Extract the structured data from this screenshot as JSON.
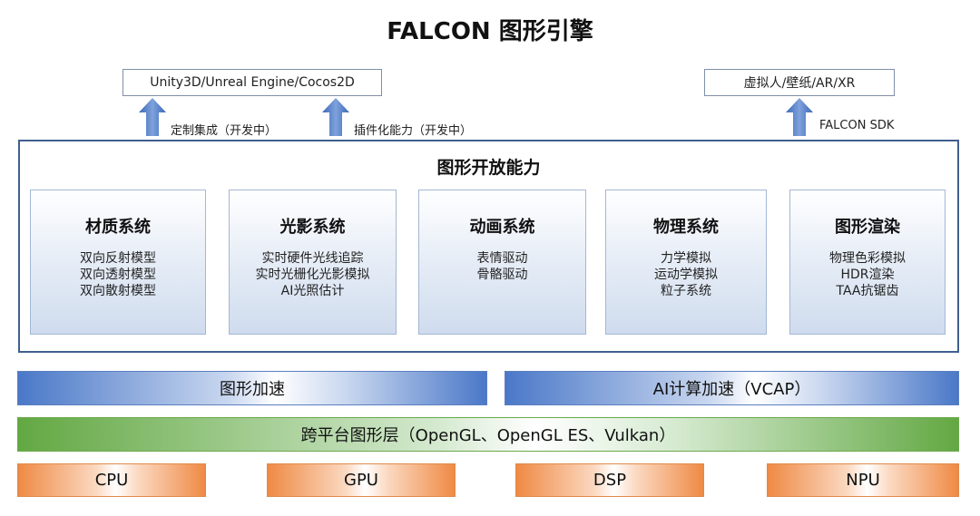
{
  "title": "FALCON 图形引擎",
  "top": {
    "engines": "Unity3D/Unreal Engine/Cocos2D",
    "sdk_targets": "虚拟人/壁纸/AR/XR",
    "arrow_custom": "定制集成（开发中）",
    "arrow_plugin": "插件化能力（开发中）",
    "arrow_sdk": "FALCON SDK"
  },
  "capabilities": {
    "title": "图形开放能力",
    "modules": [
      {
        "name": "材质系统",
        "items": [
          "双向反射模型",
          "双向透射模型",
          "双向散射模型"
        ]
      },
      {
        "name": "光影系统",
        "items": [
          "实时硬件光线追踪",
          "实时光栅化光影模拟",
          "AI光照估计"
        ]
      },
      {
        "name": "动画系统",
        "items": [
          "表情驱动",
          "骨骼驱动"
        ]
      },
      {
        "name": "物理系统",
        "items": [
          "力学模拟",
          "运动学模拟",
          "粒子系统"
        ]
      },
      {
        "name": "图形渲染",
        "items": [
          "物理色彩模拟",
          "HDR渲染",
          "TAA抗锯齿"
        ]
      }
    ]
  },
  "acceleration": {
    "graphics": "图形加速",
    "ai": "AI计算加速（VCAP）"
  },
  "platform_layer": "跨平台图形层（OpenGL、OpenGL ES、Vulkan）",
  "hardware": [
    "CPU",
    "GPU",
    "DSP",
    "NPU"
  ],
  "colors": {
    "frame": "#3f5f8f",
    "arrow": "#4a78c8",
    "accel": "#4a78c8",
    "platform": "#63a843",
    "hardware": "#ef8a45"
  }
}
